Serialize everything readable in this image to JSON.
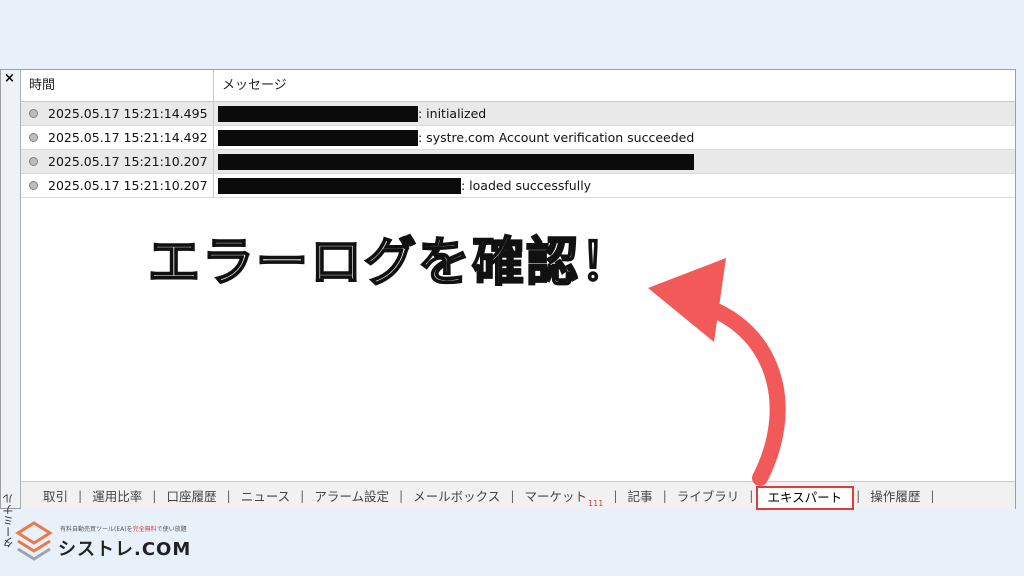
{
  "window": {
    "close_symbol": "×",
    "side_label": "ターミナル"
  },
  "table": {
    "columns": [
      "時間",
      "メッセージ"
    ],
    "rows": [
      {
        "time": "2025.05.17 15:21:14.495",
        "message": ": initialized",
        "redact_width": 200
      },
      {
        "time": "2025.05.17 15:21:14.492",
        "message": ": systre.com Account verification succeeded",
        "redact_width": 200
      },
      {
        "time": "2025.05.17 15:21:10.207",
        "message": "",
        "redact_width": 476
      },
      {
        "time": "2025.05.17 15:21:10.207",
        "message": ": loaded successfully",
        "redact_width": 243
      }
    ]
  },
  "tabs": [
    {
      "label": "取引"
    },
    {
      "label": "運用比率"
    },
    {
      "label": "口座履歴"
    },
    {
      "label": "ニュース"
    },
    {
      "label": "アラーム設定"
    },
    {
      "label": "メールボックス"
    },
    {
      "label": "マーケット",
      "badge": "111"
    },
    {
      "label": "記事"
    },
    {
      "label": "ライブラリ"
    },
    {
      "label": "エキスパート",
      "active": true
    },
    {
      "label": "操作履歴"
    }
  ],
  "callout": {
    "text": "エラーログを確認！",
    "arrow_color": "#f25a5a"
  },
  "logo": {
    "name": "シストレ.COM",
    "tagline_pre": "有料自動売買ツール(EA)を",
    "tagline_hl": "完全無料",
    "tagline_post": "で使い放題",
    "accent": "#e03a3a"
  }
}
